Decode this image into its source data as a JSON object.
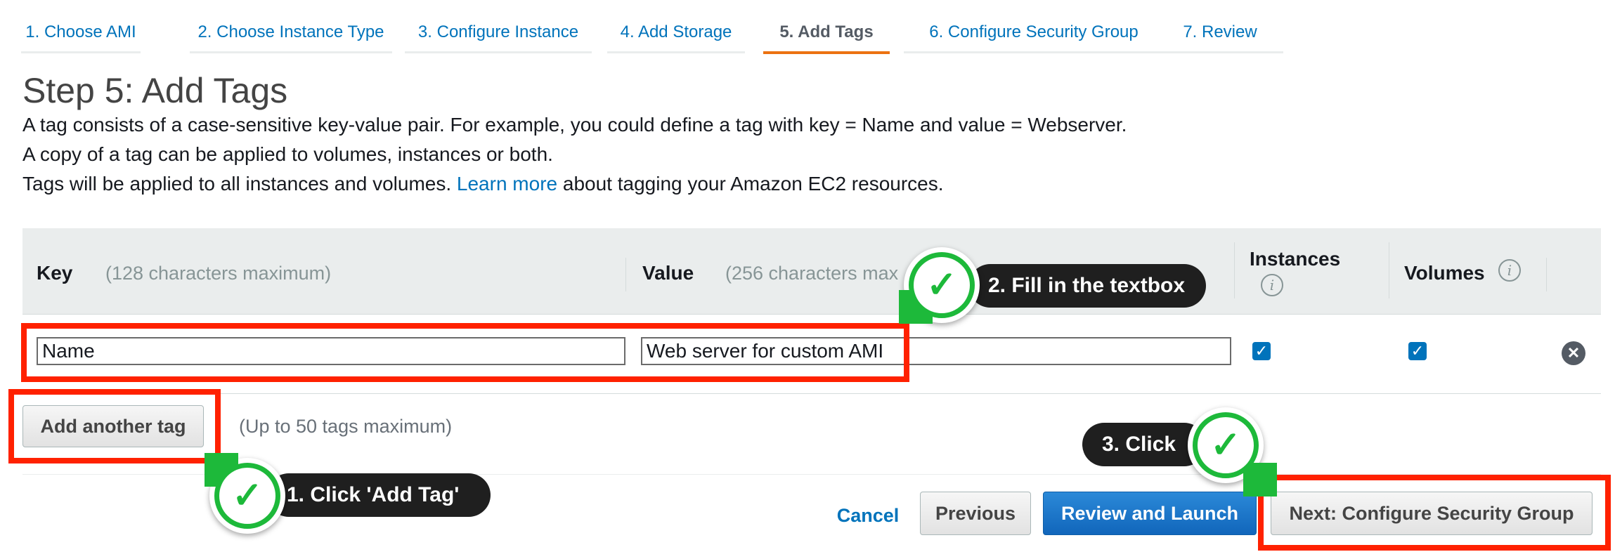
{
  "wizard": {
    "tabs": [
      {
        "label": "1. Choose AMI"
      },
      {
        "label": "2. Choose Instance Type"
      },
      {
        "label": "3. Configure Instance"
      },
      {
        "label": "4. Add Storage"
      },
      {
        "label": "5. Add Tags",
        "active": true
      },
      {
        "label": "6. Configure Security Group"
      },
      {
        "label": "7. Review"
      }
    ]
  },
  "page": {
    "title": "Step 5: Add Tags",
    "desc_line1": "A tag consists of a case-sensitive key-value pair. For example, you could define a tag with key = Name and value = Webserver.",
    "desc_line2": "A copy of a tag can be applied to volumes, instances or both.",
    "desc_line3_prefix": "Tags will be applied to all instances and volumes.",
    "learn_more": "Learn more",
    "desc_line3_suffix": "about tagging your Amazon EC2 resources."
  },
  "table": {
    "key_header": "Key",
    "key_hint": "(128 characters maximum)",
    "value_header": "Value",
    "value_hint": "(256 characters max",
    "instances_header": "Instances",
    "volumes_header": "Volumes",
    "info_icon": "info-icon",
    "rows": [
      {
        "key": "Name",
        "value": "Web server for custom AMI",
        "instances": true,
        "volumes": true
      }
    ]
  },
  "actions": {
    "add_tag": "Add another tag",
    "add_tag_hint": "(Up to 50 tags maximum)",
    "cancel": "Cancel",
    "previous": "Previous",
    "review_launch": "Review and Launch",
    "next": "Next: Configure Security Group"
  },
  "annotations": {
    "step1": "1. Click 'Add Tag'",
    "step2": "2. Fill in the textbox",
    "step3": "3. Click"
  },
  "colors": {
    "link": "#0073bb",
    "active_tab_underline": "#ec7211",
    "highlight": "#ff2100",
    "badge": "#1db93a",
    "primary_button": "#1166bb"
  }
}
